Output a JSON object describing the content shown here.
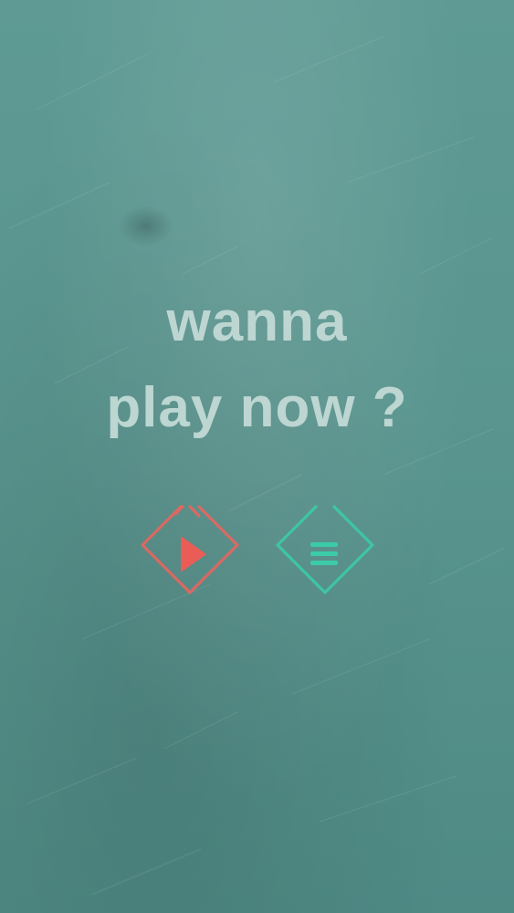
{
  "headline": {
    "line1": "wanna",
    "line2": "play now ?"
  },
  "buttons": {
    "play": {
      "icon": "play-icon",
      "color": "#e8665f"
    },
    "menu": {
      "icon": "menu-icon",
      "color": "#3ccba8"
    }
  },
  "colors": {
    "background": "#5a958f",
    "headline_text": "#c5dcd8"
  }
}
